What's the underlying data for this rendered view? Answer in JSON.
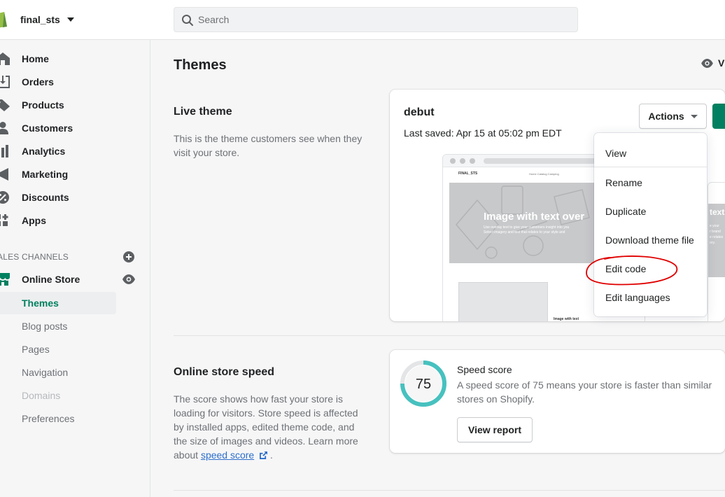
{
  "topbar": {
    "store_name": "final_sts",
    "search_placeholder": "Search"
  },
  "sidebar": {
    "items": [
      {
        "label": "Home",
        "icon": "home-icon"
      },
      {
        "label": "Orders",
        "icon": "orders-icon"
      },
      {
        "label": "Products",
        "icon": "tag-icon"
      },
      {
        "label": "Customers",
        "icon": "person-icon"
      },
      {
        "label": "Analytics",
        "icon": "bar-chart-icon"
      },
      {
        "label": "Marketing",
        "icon": "megaphone-icon"
      },
      {
        "label": "Discounts",
        "icon": "discount-icon"
      },
      {
        "label": "Apps",
        "icon": "apps-icon"
      }
    ],
    "sales_channels_label": "ALES CHANNELS",
    "online_store_label": "Online Store",
    "sub_items": [
      {
        "label": "Themes",
        "state": "active"
      },
      {
        "label": "Blog posts",
        "state": "normal"
      },
      {
        "label": "Pages",
        "state": "normal"
      },
      {
        "label": "Navigation",
        "state": "normal"
      },
      {
        "label": "Domains",
        "state": "disabled"
      },
      {
        "label": "Preferences",
        "state": "normal"
      }
    ]
  },
  "page": {
    "title": "Themes",
    "view_store_label": "Vi"
  },
  "live_theme": {
    "title": "Live theme",
    "description": "This is the theme customers see when they visit your store.",
    "theme_name": "debut",
    "last_saved": "Last saved: Apr 15 at 05:02 pm EDT",
    "actions_label": "Actions",
    "preview": {
      "brand": "FINAL_STS",
      "nav_links": "Home    Catalog    Camping",
      "hero_heading": "Image with text over",
      "hero_sub_1": "Use overlay text to give your customers insight into you",
      "hero_sub_2": "Select imagery and text that relates to your style and",
      "caption": "Image with text",
      "side_heading": "text",
      "side_sub_1": "e your",
      "side_sub_2": "r brand",
      "side_sub_3": "e relates",
      "side_sub_4": "ory."
    }
  },
  "actions_menu": {
    "items": [
      "View",
      "Rename",
      "Duplicate",
      "Download theme file",
      "Edit code",
      "Edit languages"
    ]
  },
  "speed": {
    "title": "Online store speed",
    "desc_before_link": "The score shows how fast your store is loading for visitors. Store speed is affected by installed apps, edited theme code, and the size of images and videos. Learn more about ",
    "link_label": "speed score",
    "desc_after_link": " .",
    "score": "75",
    "score_fraction": 0.75,
    "score_title": "Speed score",
    "score_desc": "A speed score of 75 means your store is faster than similar stores on Shopify.",
    "report_label": "View report"
  },
  "colors": {
    "brand_green": "#008060",
    "gauge_teal": "#47c1bf",
    "annotation_red": "#e00000"
  }
}
